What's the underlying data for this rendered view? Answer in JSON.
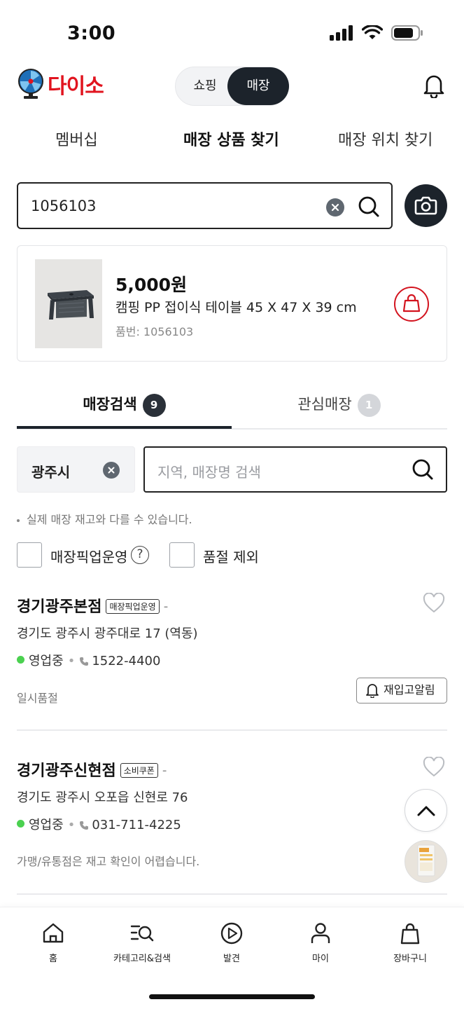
{
  "status_bar": {
    "time": "3:00"
  },
  "header": {
    "logo_text": "다이소",
    "mode_shopping": "쇼핑",
    "mode_store": "매장"
  },
  "top_tabs": [
    "멤버십",
    "매장 상품 찾기",
    "매장 위치 찾기"
  ],
  "search": {
    "value": "1056103"
  },
  "product": {
    "price": "5,000원",
    "name": "캠핑 PP 접이식 테이블 45 X 47 X 39 cm",
    "code": "품번: 1056103"
  },
  "store_tabs": [
    {
      "label": "매장검색",
      "count": "9"
    },
    {
      "label": "관심매장",
      "count": "1"
    }
  ],
  "filter": {
    "city": "광주시",
    "region_placeholder": "지역, 매장명 검색"
  },
  "notice": "실제 매장 재고와 다를 수 있습니다.",
  "checkboxes": {
    "pickup": "매장픽업운영",
    "exclude_soldout": "품절 제외"
  },
  "stores": [
    {
      "name": "경기광주본점",
      "tag": "매장픽업운영",
      "dash": "-",
      "address": "경기도 광주시 광주대로 17 (역동)",
      "status": "영업중",
      "phone": "1522-4400",
      "note": "일시품절",
      "restock_label": "재입고알림"
    },
    {
      "name": "경기광주신현점",
      "tag": "소비쿠폰",
      "dash": "-",
      "address": "경기도 광주시 오포읍 신현로 76",
      "status": "영업중",
      "phone": "031-711-4225",
      "note": "가맹/유통점은 재고 확인이 어렵습니다."
    }
  ],
  "bottom_nav": [
    "홈",
    "카테고리&검색",
    "발견",
    "마이",
    "장바구니"
  ],
  "colors": {
    "brand_red": "#e1141f",
    "dark": "#1c232b",
    "open_green": "#4bd150"
  }
}
